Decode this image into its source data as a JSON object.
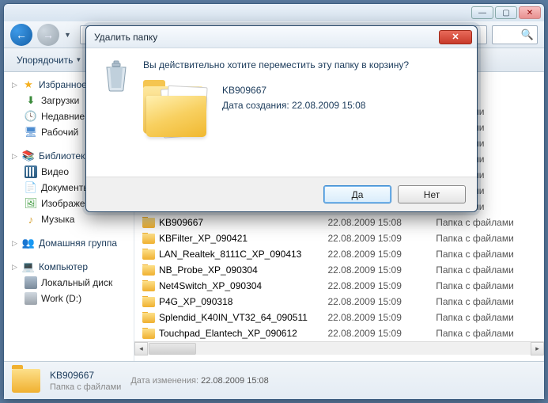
{
  "window": {
    "min_btn": "—",
    "max_btn": "▢",
    "close_btn": "✕"
  },
  "nav": {
    "back": "←",
    "fwd": "→",
    "dropdown": "▼",
    "addr_sep": "▸",
    "refresh": "⟳"
  },
  "toolbar": {
    "organize": "Упорядочить",
    "dd": "▼"
  },
  "search": {
    "icon": "🔍"
  },
  "sidebar": {
    "favorites": {
      "label": "Избранное",
      "exp": "▷"
    },
    "downloads": "Загрузки",
    "recent": "Недавние",
    "desktop": "Рабочий",
    "libraries": {
      "label": "Библиотеки",
      "exp": "▷"
    },
    "videos": "Видео",
    "documents": "Документы",
    "pictures": "Изображения",
    "music": "Музыка",
    "homegroup": {
      "label": "Домашняя группа",
      "exp": "▷"
    },
    "computer": {
      "label": "Компьютер",
      "exp": "▷"
    },
    "localdisk": "Локальный диск",
    "workd": "Work (D:)"
  },
  "files": [
    {
      "name": "",
      "date": "",
      "type": "файлами"
    },
    {
      "name": "",
      "date": "",
      "type": "файлами"
    },
    {
      "name": "",
      "date": "",
      "type": "с файлами"
    },
    {
      "name": "",
      "date": "",
      "type": "с файлами"
    },
    {
      "name": "",
      "date": "",
      "type": "с файлами"
    },
    {
      "name": "",
      "date": "",
      "type": "с файлами"
    },
    {
      "name": "",
      "date": "",
      "type": "с файлами"
    },
    {
      "name": "",
      "date": "",
      "type": "с файлами"
    },
    {
      "name": "",
      "date": "",
      "type": "с файлами"
    },
    {
      "name": "KB909667",
      "date": "22.08.2009 15:08",
      "type": "Папка с файлами"
    },
    {
      "name": "KBFilter_XP_090421",
      "date": "22.08.2009 15:09",
      "type": "Папка с файлами"
    },
    {
      "name": "LAN_Realtek_8111C_XP_090413",
      "date": "22.08.2009 15:09",
      "type": "Папка с файлами"
    },
    {
      "name": "NB_Probe_XP_090304",
      "date": "22.08.2009 15:09",
      "type": "Папка с файлами"
    },
    {
      "name": "Net4Switch_XP_090304",
      "date": "22.08.2009 15:09",
      "type": "Папка с файлами"
    },
    {
      "name": "P4G_XP_090318",
      "date": "22.08.2009 15:09",
      "type": "Папка с файлами"
    },
    {
      "name": "Splendid_K40IN_VT32_64_090511",
      "date": "22.08.2009 15:09",
      "type": "Папка с файлами"
    },
    {
      "name": "Touchpad_Elantech_XP_090612",
      "date": "22.08.2009 15:09",
      "type": "Папка с файлами"
    }
  ],
  "status": {
    "name": "KB909667",
    "type": "Папка с файлами",
    "meta_label": "Дата изменения:",
    "meta_value": "22.08.2009 15:08"
  },
  "dialog": {
    "title": "Удалить папку",
    "close": "✕",
    "question": "Вы действительно хотите переместить эту папку в корзину?",
    "item_name": "KB909667",
    "created_label": "Дата создания:",
    "created_value": "22.08.2009 15:08",
    "yes": "Да",
    "no": "Нет"
  }
}
